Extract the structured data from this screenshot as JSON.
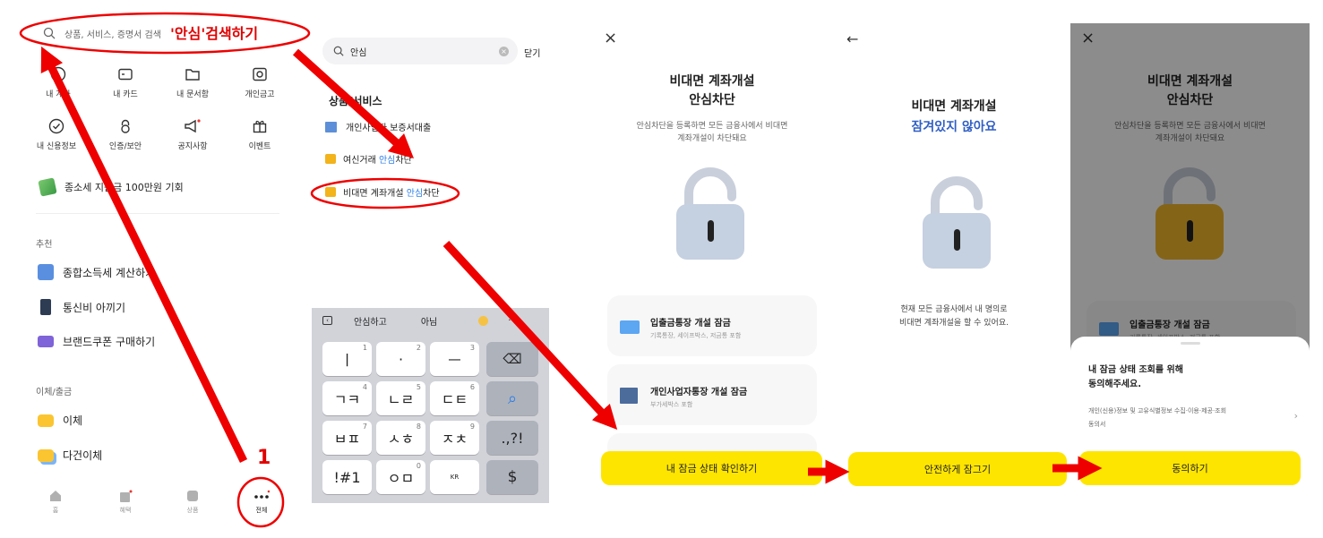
{
  "p1": {
    "search_placeholder": "상품, 서비스, 증명서 검색",
    "search_highlight": "'안심'검색하기",
    "grid_row1": [
      "내 계좌",
      "내 카드",
      "내 문서함",
      "개인금고"
    ],
    "grid_row2": [
      "내 신용정보",
      "인증/보안",
      "공지사항",
      "이벤트"
    ],
    "promo": "종소세 지원금 100만원 기회",
    "section_recommend": "추천",
    "recommend_items": [
      "종합소득세 계산하기",
      "통신비 아끼기",
      "브랜드쿠폰 구매하기"
    ],
    "section_transfer": "이체/출금",
    "transfer_items": [
      "이체",
      "다건이체"
    ],
    "tabs": [
      "홈",
      "혜택",
      "상품",
      "전체"
    ],
    "step_number": "1"
  },
  "p2": {
    "search_value": "안심",
    "close_label": "닫기",
    "section_title": "상품/서비스",
    "results": [
      {
        "pre": "개인사업자 보증서대출",
        "hl": "",
        "post": ""
      },
      {
        "pre": "여신거래 ",
        "hl": "안심",
        "post": "차단"
      },
      {
        "pre": "비대면 계좌개설 ",
        "hl": "안심",
        "post": "차단"
      }
    ],
    "suggestions": [
      "안심하고",
      "아님"
    ],
    "keys": [
      [
        "ㅣ",
        "·",
        "ㅡ",
        "⌫"
      ],
      [
        "ㄱㅋ",
        "ㄴㄹ",
        "ㄷㅌ",
        "⌕"
      ],
      [
        "ㅂㅍ",
        "ㅅㅎ",
        "ㅈㅊ",
        ".,?!"
      ],
      [
        "!#1",
        "ㅇㅁ",
        "KR",
        "$"
      ]
    ],
    "key_nums": [
      "1",
      "2",
      "3",
      "4",
      "5",
      "6",
      "7",
      "8",
      "9",
      "0"
    ]
  },
  "p3": {
    "title1": "비대면 계좌개설",
    "title2": "안심차단",
    "desc1": "안심차단을 등록하면 모든 금융사에서 비대면",
    "desc2": "계좌개설이 차단돼요",
    "card1_title": "입출금통장 개설 잠금",
    "card1_sub": "기록통장, 세이프박스, 저금통 포함",
    "card2_title": "개인사업자통장 개설 잠금",
    "card2_sub": "부가세박스 포함",
    "button": "내 잠금 상태 확인하기"
  },
  "p4": {
    "title1": "비대면 계좌개설",
    "title2": "잠겨있지 않아요",
    "desc1": "현재 모든 금융사에서 내 명의로",
    "desc2": "비대면 계좌개설을 할 수 있어요.",
    "button": "안전하게 잠그기"
  },
  "p5": {
    "title1": "비대면 계좌개설",
    "title2": "안심차단",
    "desc1": "안심차단을 등록하면 모든 금융사에서 비대면",
    "desc2": "계좌개설이 차단돼요",
    "card_title": "입출금통장 개설 잠금",
    "card_sub": "기록통장, 세이프박스, 저금통 포함",
    "sheet_title1": "내 잠금 상태 조회를 위해",
    "sheet_title2": "동의해주세요.",
    "sheet_item1": "개인(신용)정보 및 고유식별정보 수집·이용·제공·조회",
    "sheet_item2": "동의서",
    "button": "동의하기"
  },
  "colors": {
    "accent_yellow": "#fee500",
    "blue_title": "#2f5ec4",
    "annotation_red": "#ee0000",
    "highlight_blue": "#2b7de9"
  }
}
